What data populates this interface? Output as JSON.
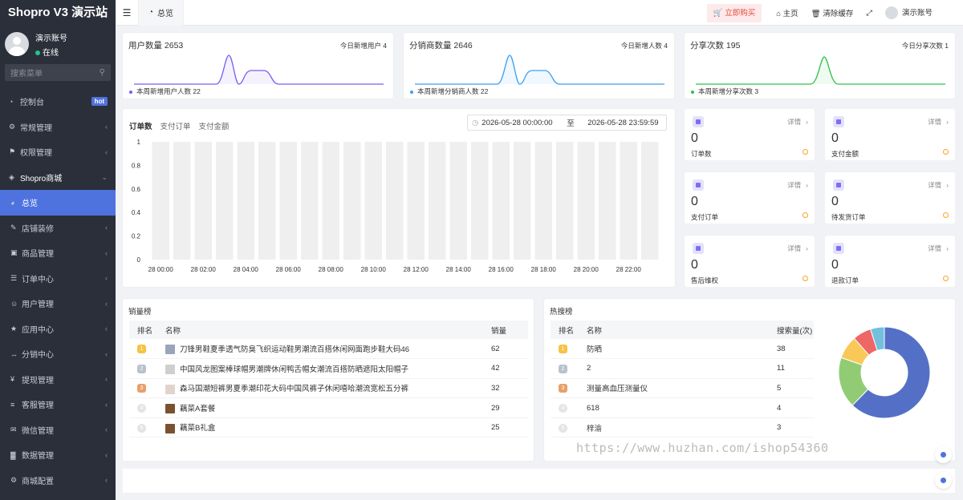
{
  "brand": "Shopro V3 演示站",
  "user": {
    "name": "演示账号",
    "status": "在线"
  },
  "search": {
    "placeholder": "搜索菜单"
  },
  "menu": [
    {
      "label": "控制台",
      "icon": "dashboard-icon",
      "badge": "hot"
    },
    {
      "label": "常规管理",
      "icon": "cogs-icon"
    },
    {
      "label": "权限管理",
      "icon": "group-icon"
    },
    {
      "label": "Shopro商城",
      "icon": "dropbox-icon",
      "open": true
    },
    {
      "label": "总览",
      "icon": "pie-icon",
      "active": true
    },
    {
      "label": "店铺装修",
      "icon": "brush-icon"
    },
    {
      "label": "商品管理",
      "icon": "goods-icon"
    },
    {
      "label": "订单中心",
      "icon": "order-icon"
    },
    {
      "label": "用户管理",
      "icon": "user-icon"
    },
    {
      "label": "应用中心",
      "icon": "star-icon"
    },
    {
      "label": "分销中心",
      "icon": "share-icon"
    },
    {
      "label": "提现管理",
      "icon": "yen-icon"
    },
    {
      "label": "客服管理",
      "icon": "list-icon"
    },
    {
      "label": "微信管理",
      "icon": "wechat-icon"
    },
    {
      "label": "数据管理",
      "icon": "chart-icon"
    },
    {
      "label": "商城配置",
      "icon": "cogs-icon"
    }
  ],
  "topbar": {
    "tab": "总览",
    "buy": "立即购买",
    "home": "主页",
    "cache": "清除缓存",
    "account": "演示账号"
  },
  "stats": [
    {
      "title": "用户数量 2653",
      "today": "今日新增用户 4",
      "foot": "本周新增用户人数  22",
      "color": "#7b5cf0"
    },
    {
      "title": "分销商数量 2646",
      "today": "今日新增人数 4",
      "foot": "本周新增分销商人数  22",
      "color": "#3a9ff0"
    },
    {
      "title": "分享次数 195",
      "today": "今日分享次数 1",
      "foot": "本周新增分享次数  3",
      "color": "#2ec04a"
    }
  ],
  "orders": {
    "tabs": [
      "订单数",
      "支付订单",
      "支付金额"
    ],
    "date_start": "2026-05-28 00:00:00",
    "date_sep": "至",
    "date_end": "2026-05-28 23:59:59"
  },
  "chart_data": {
    "type": "bar",
    "y_ticks": [
      "1",
      "0.8",
      "0.6",
      "0.4",
      "0.2",
      "0"
    ],
    "ylim": [
      0,
      1
    ],
    "categories": [
      "28 00:00",
      "28 01:00",
      "28 02:00",
      "28 03:00",
      "28 04:00",
      "28 05:00",
      "28 06:00",
      "28 07:00",
      "28 08:00",
      "28 09:00",
      "28 10:00",
      "28 11:00",
      "28 12:00",
      "28 13:00",
      "28 14:00",
      "28 15:00",
      "28 16:00",
      "28 17:00",
      "28 18:00",
      "28 19:00",
      "28 20:00",
      "28 21:00",
      "28 22:00",
      "28 23:00"
    ],
    "x_tick_labels": [
      "28 00:00",
      "28 02:00",
      "28 04:00",
      "28 06:00",
      "28 08:00",
      "28 10:00",
      "28 12:00",
      "28 14:00",
      "28 16:00",
      "28 18:00",
      "28 20:00",
      "28 22:00"
    ],
    "values": [
      0,
      0,
      0,
      0,
      0,
      0,
      0,
      0,
      0,
      0,
      0,
      0,
      0,
      0,
      0,
      0,
      0,
      0,
      0,
      0,
      0,
      0,
      0,
      0
    ]
  },
  "mini_cards": [
    {
      "value": "0",
      "label": "订单数",
      "detail": "详情"
    },
    {
      "value": "0",
      "label": "支付金额",
      "detail": "详情"
    },
    {
      "value": "0",
      "label": "支付订单",
      "detail": "详情"
    },
    {
      "value": "0",
      "label": "待发货订单",
      "detail": "详情"
    },
    {
      "value": "0",
      "label": "售后维权",
      "detail": "详情"
    },
    {
      "value": "0",
      "label": "退款订单",
      "detail": "详情"
    }
  ],
  "sales": {
    "title": "销量榜",
    "headers": [
      "排名",
      "名称",
      "销量"
    ],
    "rows": [
      {
        "rank": "1",
        "name": "刀锋男鞋夏季透气防臭飞织运动鞋男潮流百搭休闲网面跑步鞋大码46",
        "value": "62",
        "color": "#f6c343",
        "img": "#9aa4bb"
      },
      {
        "rank": "2",
        "name": "中国风龙图案棒球帽男潮牌休闲鸭舌帽女潮流百搭防晒遮阳太阳帽子",
        "value": "42",
        "color": "#b8c2cc",
        "img": "#cfcfcf"
      },
      {
        "rank": "3",
        "name": "森马国潮短裤男夏季潮印花大码中国风裤子休闲嘻哈潮流宽松五分裤",
        "value": "32",
        "color": "#e8a06a",
        "img": "#e0d4cc"
      },
      {
        "rank": "4",
        "name": "藕菜A套餐",
        "value": "29",
        "color": "#e4e4e4",
        "img": "#7a5230"
      },
      {
        "rank": "5",
        "name": "藕菜B礼盒",
        "value": "25",
        "color": "#e4e4e4",
        "img": "#7a5230"
      }
    ]
  },
  "hot": {
    "title": "热搜榜",
    "headers": [
      "排名",
      "名称",
      "搜索量(次)"
    ],
    "rows": [
      {
        "rank": "1",
        "name": "防晒",
        "value": "38",
        "color": "#f6c343"
      },
      {
        "rank": "2",
        "name": "2",
        "value": "11",
        "color": "#b8c2cc"
      },
      {
        "rank": "3",
        "name": "测量高血压测量仪",
        "value": "5",
        "color": "#e8a06a"
      },
      {
        "rank": "4",
        "name": "618",
        "value": "4",
        "color": "#e4e4e4"
      },
      {
        "rank": "5",
        "name": "梓渝",
        "value": "3",
        "color": "#e4e4e4"
      }
    ],
    "donut": [
      {
        "name": "防晒",
        "value": 38,
        "color": "#5470c6"
      },
      {
        "name": "2",
        "value": 11,
        "color": "#91cc75"
      },
      {
        "name": "测量高血压测量仪",
        "value": 5,
        "color": "#fac858"
      },
      {
        "name": "618",
        "value": 4,
        "color": "#ee6666"
      },
      {
        "name": "梓渝",
        "value": 3,
        "color": "#73c0de"
      }
    ]
  },
  "watermark": "https://www.huzhan.com/ishop54360"
}
